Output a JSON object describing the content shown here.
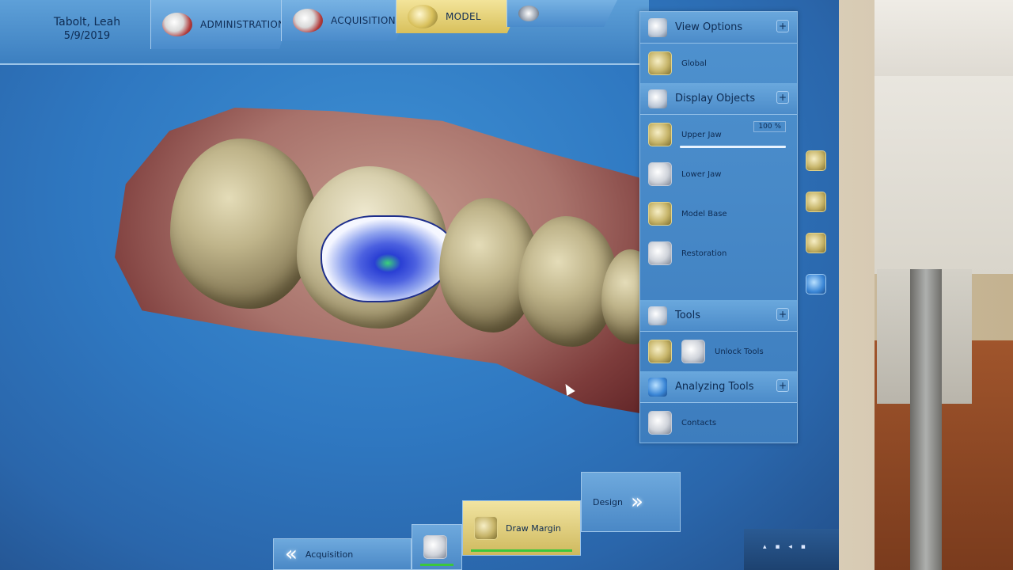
{
  "patient": {
    "name": "Tabolt, Leah",
    "date": "5/9/2019"
  },
  "tabs": [
    {
      "label": "ADMINISTRATION",
      "icon": "jaw-icon"
    },
    {
      "label": "ACQUISITION",
      "icon": "teeth-scan-icon"
    },
    {
      "label": "MODEL",
      "icon": "model-tooth-icon"
    }
  ],
  "panels": {
    "view_options": {
      "title": "View Options",
      "pin": "+",
      "items": [
        {
          "label": "Global"
        }
      ]
    },
    "display_objects": {
      "title": "Display Objects",
      "pin": "+",
      "items": [
        {
          "label": "Upper Jaw",
          "value": "100 %",
          "level": 1.0
        },
        {
          "label": "Lower Jaw"
        },
        {
          "label": "Model Base"
        },
        {
          "label": "Restoration"
        }
      ]
    },
    "tools": {
      "title": "Tools",
      "pin": "+",
      "items": [
        {
          "label": ""
        },
        {
          "label": "Unlock Tools"
        }
      ]
    },
    "analyzing_tools": {
      "title": "Analyzing Tools",
      "pin": "+",
      "items": [
        {
          "label": "Contacts"
        }
      ]
    }
  },
  "workflow": [
    {
      "label": "Acquisition",
      "direction": "back"
    },
    {
      "label": "Draw Margin",
      "active": true
    },
    {
      "label": "Design",
      "direction": "forward"
    }
  ],
  "colors": {
    "active_tab": "#d8c05b",
    "ui_blue": "#3c7fc0",
    "margin_line": "#1f2f8c"
  }
}
